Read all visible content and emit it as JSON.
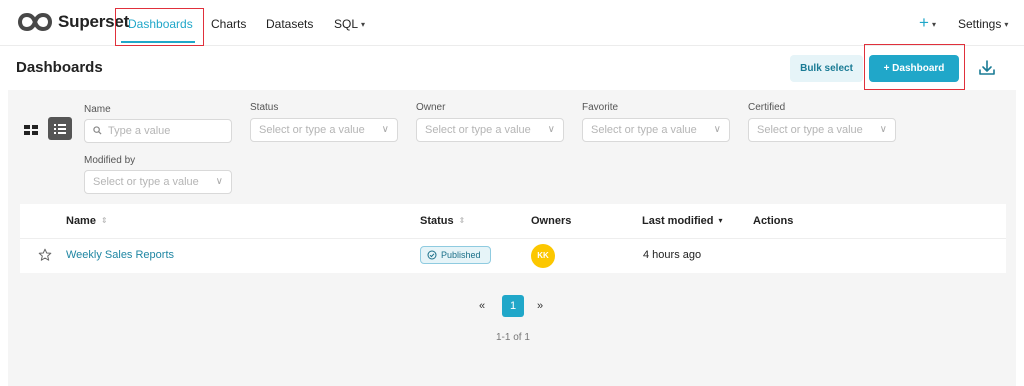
{
  "app": {
    "name": "Superset"
  },
  "nav": {
    "items": [
      {
        "label": "Dashboards",
        "active": true
      },
      {
        "label": "Charts"
      },
      {
        "label": "Datasets"
      },
      {
        "label": "SQL"
      }
    ],
    "plus_label": "+",
    "settings_label": "Settings"
  },
  "header": {
    "title": "Dashboards",
    "bulk_select_label": "Bulk select",
    "add_dashboard_label": "+ Dashboard"
  },
  "filters": [
    {
      "label": "Name",
      "placeholder": "Type a value",
      "type": "search"
    },
    {
      "label": "Status",
      "placeholder": "Select or type a value",
      "type": "select"
    },
    {
      "label": "Owner",
      "placeholder": "Select or type a value",
      "type": "select"
    },
    {
      "label": "Favorite",
      "placeholder": "Select or type a value",
      "type": "select"
    },
    {
      "label": "Certified",
      "placeholder": "Select or type a value",
      "type": "select"
    },
    {
      "label": "Modified by",
      "placeholder": "Select or type a value",
      "type": "select"
    }
  ],
  "table": {
    "columns": [
      "Name",
      "Status",
      "Owners",
      "Last modified",
      "Actions"
    ],
    "rows": [
      {
        "name": "Weekly Sales Reports",
        "status": "Published",
        "owner_initials": "KK",
        "last_modified": "4 hours ago"
      }
    ]
  },
  "pagination": {
    "prev": "«",
    "current_page": "1",
    "next": "»",
    "range_text": "1-1 of 1"
  },
  "colors": {
    "accent": "#20a7c9",
    "highlight_box": "#e0303b",
    "avatar": "#fcc700"
  }
}
